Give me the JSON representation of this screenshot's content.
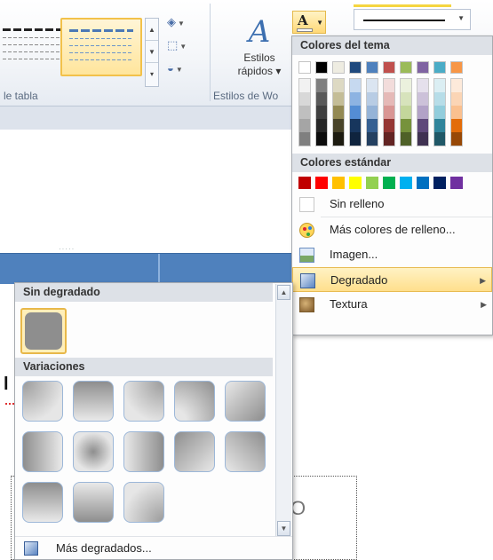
{
  "ribbon": {
    "group_table_styles_label": "le tabla",
    "quick_styles_label_1": "Estilos",
    "quick_styles_label_2": "rápidos",
    "quick_styles_dropdown": "▾",
    "group_wordart_label": "Estilos de Wo",
    "font_color_letter": "A"
  },
  "color_menu": {
    "theme_header": "Colores del tema",
    "theme_top": [
      "#ffffff",
      "#000000",
      "#eeece1",
      "#1f497d",
      "#4f81bd",
      "#c0504d",
      "#9bbb59",
      "#8064a2",
      "#4bacc6",
      "#f79646"
    ],
    "theme_shades": [
      [
        "#f2f2f2",
        "#d8d8d8",
        "#bfbfbf",
        "#a5a5a5",
        "#7f7f7f"
      ],
      [
        "#7f7f7f",
        "#595959",
        "#3f3f3f",
        "#262626",
        "#0c0c0c"
      ],
      [
        "#ddd9c3",
        "#c4bd97",
        "#938953",
        "#494429",
        "#1d1b10"
      ],
      [
        "#c6d9f0",
        "#8db3e2",
        "#548dd4",
        "#17365d",
        "#0f243e"
      ],
      [
        "#dbe5f1",
        "#b8cce4",
        "#95b3d7",
        "#366092",
        "#244061"
      ],
      [
        "#f2dcdb",
        "#e5b9b7",
        "#d99694",
        "#953734",
        "#632423"
      ],
      [
        "#ebf1dd",
        "#d7e3bc",
        "#c3d69b",
        "#76923c",
        "#4f6128"
      ],
      [
        "#e5e0ec",
        "#ccc1d9",
        "#b2a2c7",
        "#5f497a",
        "#3f3151"
      ],
      [
        "#dbeef3",
        "#b7dde8",
        "#92cddc",
        "#31859b",
        "#205867"
      ],
      [
        "#fdeada",
        "#fbd5b5",
        "#fac08f",
        "#e36c09",
        "#974806"
      ]
    ],
    "standard_header": "Colores estándar",
    "standard": [
      "#c00000",
      "#ff0000",
      "#ffc000",
      "#ffff00",
      "#92d050",
      "#00b050",
      "#00b0f0",
      "#0070c0",
      "#002060",
      "#7030a0"
    ],
    "no_fill": "Sin relleno",
    "more_fill_colors": "Más colores de relleno...",
    "picture": "Imagen...",
    "gradient": "Degradado",
    "texture": "Textura"
  },
  "gradient_menu": {
    "no_gradient_header": "Sin degradado",
    "variations_header": "Variaciones",
    "variations": [
      "radial-gradient(ellipse at 0% 0%, #9b9b9b 0%, #e6e6e6 75%)",
      "linear-gradient(180deg, #8e8e8e 0%, #e9e9e9 100%)",
      "radial-gradient(ellipse at 100% 0%, #9b9b9b 0%, #e6e6e6 75%)",
      "radial-gradient(ellipse at 0% 100%, #e6e6e6 0%, #e6e6e6 20%, #8e8e8e 100%)",
      "linear-gradient(135deg, #e8e8e8 0%, #8e8e8e 100%)",
      "linear-gradient(90deg, #8e8e8e 0%, #e9e9e9 100%)",
      "radial-gradient(circle at 50% 50%, #8e8e8e 0%, #e6e6e6 70%)",
      "linear-gradient(90deg, #e9e9e9 0%, #8e8e8e 100%)",
      "linear-gradient(315deg, #e8e8e8 0%, #8e8e8e 100%)",
      "linear-gradient(45deg, #e8e8e8 0%, #8e8e8e 100%)",
      "linear-gradient(0deg, #e9e9e9 0%, #8e8e8e 100%)",
      "linear-gradient(0deg, #8e8e8e 0%, #e9e9e9 100%)",
      "radial-gradient(ellipse at 100% 100%, #9b9b9b 0%, #e6e6e6 75%)"
    ],
    "more_gradients": "Más degradados..."
  }
}
